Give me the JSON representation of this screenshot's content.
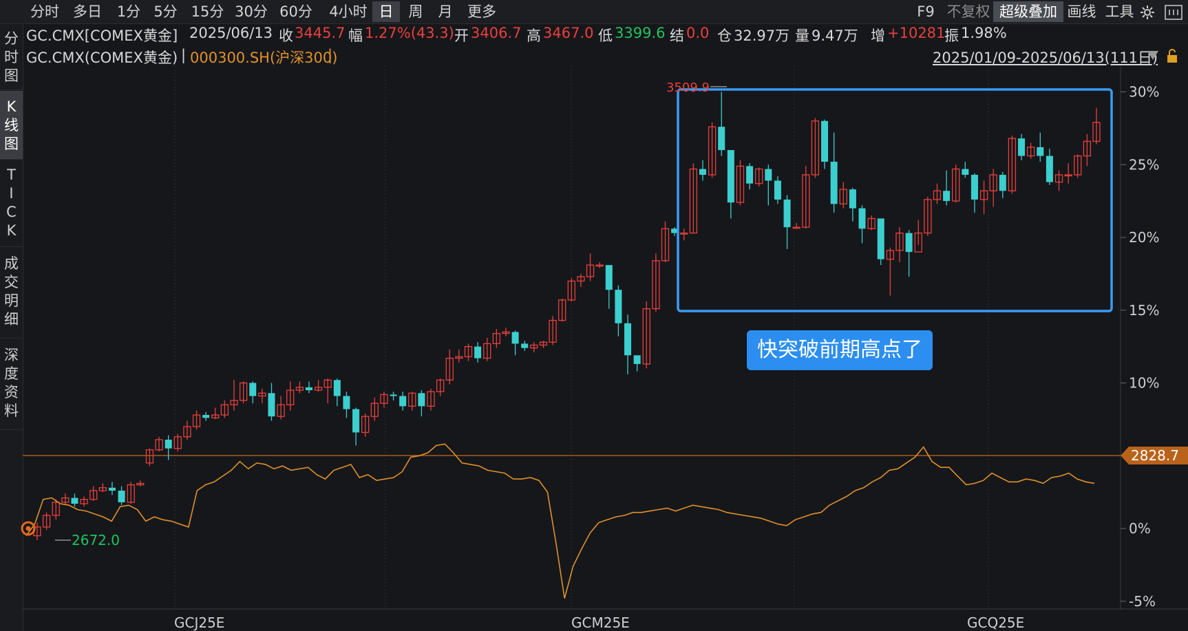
{
  "toolbar": {
    "timeframes": [
      "分时",
      "多日",
      "1分",
      "5分",
      "15分",
      "30分",
      "60分",
      "4小时",
      "日",
      "周",
      "月",
      "更多"
    ],
    "active_timeframe": "日",
    "right_tools": [
      "F9",
      "不复权",
      "超级叠加",
      "画线",
      "工具"
    ],
    "active_tool": "超级叠加",
    "dim_tool": "不复权",
    "settings_icon": "gear-icon"
  },
  "sidebar": {
    "items": [
      {
        "label": "分\n时\n图",
        "active": false
      },
      {
        "label": "K\n线\n图",
        "active": true
      },
      {
        "label": "T\nI\nC\nK",
        "active": false
      },
      {
        "label": "成\n交\n明\n细",
        "active": false
      },
      {
        "label": "深\n度\n资\n料",
        "active": false
      }
    ]
  },
  "info_line1": {
    "symbol": "GC.CMX[COMEX黄金]",
    "date": "2025/06/13",
    "close_label": "收",
    "close_value": "3445.7",
    "change_label": "幅",
    "change_value": "1.27%(43.3)",
    "open_label": "开",
    "open_value": "3406.7",
    "high_label": "高",
    "high_value": "3467.0",
    "low_label": "低",
    "low_value": "3399.6",
    "settle_label": "结",
    "settle_value": "0.0",
    "oi_label": "仓",
    "oi_value": "32.97万",
    "volume_label": "量",
    "volume_value": "9.47万",
    "increase_label": "增",
    "increase_value": "+10281",
    "amplitude_label": "振",
    "amplitude_value": "1.98%"
  },
  "info_line2": {
    "main_series": "GC.CMX(COMEX黄金)",
    "separator": "|",
    "overlay_series": "000300.SH(沪深300)",
    "separator2": "|",
    "date_range": "2025/01/09-2025/06/13(111日)"
  },
  "chart_data": {
    "type": "candlestick",
    "y_axis_ticks": [
      "30%",
      "25%",
      "20%",
      "15%",
      "10%",
      "0%",
      "-5%"
    ],
    "x_axis_labels": [
      "GCJ25E",
      "GCM25E",
      "GCQ25E"
    ],
    "high_annotation": "3509.9",
    "low_annotation": "2672.0",
    "price_tag": "2828.7",
    "colors": {
      "up": "#e8413c",
      "down": "#3ccfcf",
      "overlay": "#e0922a",
      "highlight_box": "#3a9bf5"
    },
    "candles_pct": [
      [
        -0.5,
        0.1,
        -0.8,
        0.4
      ],
      [
        0.1,
        0.9,
        -0.1,
        1.1
      ],
      [
        0.9,
        1.8,
        0.6,
        2.0
      ],
      [
        1.8,
        2.1,
        1.6,
        2.4
      ],
      [
        2.1,
        1.7,
        1.5,
        2.4
      ],
      [
        1.7,
        2.0,
        1.5,
        2.2
      ],
      [
        2.0,
        2.6,
        1.9,
        2.9
      ],
      [
        2.6,
        2.8,
        2.5,
        3.1
      ],
      [
        2.8,
        2.6,
        2.3,
        3.2
      ],
      [
        2.6,
        1.8,
        1.6,
        2.9
      ],
      [
        1.8,
        3.0,
        1.7,
        3.2
      ],
      [
        3.0,
        3.1,
        2.9,
        3.3
      ],
      [
        4.5,
        5.4,
        4.3,
        5.5
      ],
      [
        5.4,
        6.1,
        5.3,
        6.3
      ],
      [
        6.1,
        5.5,
        4.7,
        6.4
      ],
      [
        5.5,
        6.3,
        5.3,
        6.5
      ],
      [
        6.3,
        7.0,
        6.1,
        7.4
      ],
      [
        7.0,
        7.8,
        6.8,
        8.1
      ],
      [
        7.8,
        7.6,
        7.4,
        8.0
      ],
      [
        7.6,
        7.8,
        7.5,
        8.3
      ],
      [
        7.8,
        8.5,
        7.6,
        8.8
      ],
      [
        8.5,
        8.8,
        8.1,
        10.2
      ],
      [
        8.8,
        10.0,
        8.6,
        10.1
      ],
      [
        10.0,
        9.1,
        8.6,
        10.1
      ],
      [
        9.1,
        9.3,
        8.6,
        9.6
      ],
      [
        9.3,
        7.7,
        7.4,
        10.0
      ],
      [
        7.7,
        8.5,
        7.5,
        9.1
      ],
      [
        8.5,
        9.5,
        8.1,
        10.1
      ],
      [
        9.5,
        9.7,
        9.3,
        10.1
      ],
      [
        9.7,
        9.5,
        9.3,
        10.1
      ],
      [
        9.5,
        9.7,
        9.4,
        10.2
      ],
      [
        9.7,
        10.2,
        8.6,
        10.3
      ],
      [
        10.2,
        9.1,
        8.4,
        10.3
      ],
      [
        9.1,
        8.2,
        7.6,
        9.4
      ],
      [
        8.2,
        6.6,
        5.7,
        8.3
      ],
      [
        6.6,
        7.7,
        6.3,
        7.9
      ],
      [
        7.7,
        8.6,
        7.4,
        9.0
      ],
      [
        8.6,
        9.2,
        8.3,
        9.4
      ],
      [
        9.2,
        9.1,
        8.8,
        9.4
      ],
      [
        9.1,
        8.4,
        8.1,
        9.4
      ],
      [
        8.4,
        9.3,
        8.1,
        9.4
      ],
      [
        9.3,
        8.4,
        7.7,
        9.5
      ],
      [
        8.4,
        9.4,
        8.1,
        9.6
      ],
      [
        9.4,
        10.2,
        9.1,
        10.3
      ],
      [
        10.2,
        11.7,
        9.9,
        12.3
      ],
      [
        11.7,
        11.8,
        11.4,
        12.3
      ],
      [
        11.8,
        12.5,
        11.5,
        12.7
      ],
      [
        12.5,
        11.7,
        11.4,
        12.8
      ],
      [
        11.7,
        12.7,
        11.5,
        13.1
      ],
      [
        12.7,
        13.4,
        12.4,
        13.7
      ],
      [
        13.4,
        13.5,
        13.2,
        13.8
      ],
      [
        13.5,
        12.7,
        11.9,
        13.6
      ],
      [
        12.7,
        12.4,
        12.2,
        12.9
      ],
      [
        12.4,
        12.6,
        12.1,
        12.8
      ],
      [
        12.6,
        12.8,
        12.4,
        12.9
      ],
      [
        12.8,
        14.3,
        12.6,
        14.6
      ],
      [
        14.3,
        15.7,
        14.2,
        15.8
      ],
      [
        15.7,
        17.0,
        15.6,
        17.2
      ],
      [
        17.0,
        17.3,
        16.6,
        17.5
      ],
      [
        17.3,
        18.1,
        17.0,
        18.9
      ],
      [
        18.1,
        18.1,
        17.9,
        18.3
      ],
      [
        18.1,
        16.4,
        15.1,
        17.9
      ],
      [
        16.4,
        14.1,
        13.2,
        16.7
      ],
      [
        14.1,
        11.9,
        10.6,
        14.7
      ],
      [
        11.9,
        11.3,
        10.8,
        11.6
      ],
      [
        11.3,
        15.1,
        11.0,
        15.6
      ],
      [
        15.1,
        18.4,
        14.9,
        18.9
      ],
      [
        18.4,
        20.6,
        18.3,
        21.1
      ],
      [
        20.6,
        20.3,
        20.1,
        20.7
      ],
      [
        20.3,
        20.3,
        19.8,
        20.6
      ],
      [
        20.3,
        24.7,
        20.3,
        25.1
      ],
      [
        24.7,
        24.3,
        23.9,
        25.3
      ],
      [
        24.3,
        27.6,
        24.1,
        27.9
      ],
      [
        27.6,
        26.0,
        25.6,
        30.0
      ],
      [
        26.0,
        22.4,
        21.3,
        25.8
      ],
      [
        22.4,
        24.9,
        22.2,
        25.3
      ],
      [
        24.9,
        23.7,
        23.3,
        25.1
      ],
      [
        23.7,
        24.7,
        23.5,
        24.8
      ],
      [
        24.7,
        23.9,
        22.2,
        25.0
      ],
      [
        23.9,
        22.6,
        22.3,
        24.2
      ],
      [
        22.6,
        20.7,
        19.2,
        22.9
      ],
      [
        20.7,
        20.7,
        20.6,
        21.0
      ],
      [
        20.7,
        24.3,
        20.6,
        24.9
      ],
      [
        24.3,
        28.0,
        24.1,
        28.2
      ],
      [
        28.0,
        25.2,
        24.7,
        28.1
      ],
      [
        25.2,
        22.3,
        21.7,
        27.2
      ],
      [
        22.3,
        23.3,
        22.0,
        23.8
      ],
      [
        23.3,
        22.0,
        21.1,
        23.4
      ],
      [
        22.0,
        20.6,
        19.6,
        22.2
      ],
      [
        20.6,
        21.3,
        20.5,
        21.5
      ],
      [
        21.3,
        18.5,
        18.1,
        21.1
      ],
      [
        18.5,
        19.1,
        16.0,
        19.3
      ],
      [
        19.1,
        20.3,
        18.3,
        20.7
      ],
      [
        20.3,
        19.0,
        17.3,
        20.5
      ],
      [
        19.0,
        20.3,
        19.5,
        21.2
      ],
      [
        20.3,
        22.6,
        20.1,
        22.8
      ],
      [
        22.6,
        23.2,
        22.3,
        23.7
      ],
      [
        23.2,
        22.5,
        22.2,
        24.6
      ],
      [
        22.5,
        24.7,
        22.4,
        25.0
      ],
      [
        24.7,
        24.3,
        24.1,
        25.2
      ],
      [
        24.3,
        22.6,
        21.7,
        24.4
      ],
      [
        22.6,
        23.2,
        21.6,
        23.9
      ],
      [
        23.2,
        24.3,
        22.1,
        24.7
      ],
      [
        24.3,
        23.2,
        22.7,
        24.5
      ],
      [
        23.2,
        26.8,
        23.0,
        27.0
      ],
      [
        26.8,
        25.6,
        25.3,
        27.1
      ],
      [
        25.6,
        26.2,
        25.4,
        26.5
      ],
      [
        26.2,
        25.6,
        25.2,
        27.2
      ],
      [
        25.6,
        23.8,
        23.6,
        26.1
      ],
      [
        23.8,
        24.3,
        23.2,
        24.6
      ],
      [
        24.3,
        24.3,
        23.7,
        25.1
      ],
      [
        24.3,
        25.6,
        24.1,
        25.7
      ],
      [
        25.6,
        26.6,
        24.9,
        27.1
      ],
      [
        26.6,
        27.9,
        26.4,
        28.9
      ]
    ],
    "overlay_pct": [
      -0.5,
      0.3,
      2.0,
      2.1,
      1.7,
      1.6,
      1.3,
      1.2,
      1.0,
      0.8,
      0.5,
      1.5,
      1.6,
      1.3,
      0.5,
      0.8,
      0.6,
      0.5,
      0.3,
      0.1,
      2.6,
      3.0,
      3.2,
      3.6,
      4.0,
      4.6,
      4.1,
      4.5,
      4.4,
      4.1,
      4.3,
      4.0,
      4.1,
      4.2,
      3.7,
      3.4,
      4.0,
      4.2,
      4.4,
      3.5,
      3.7,
      3.3,
      3.4,
      3.5,
      3.9,
      4.9,
      5.0,
      5.2,
      5.7,
      5.8,
      5.2,
      4.5,
      4.4,
      4.3,
      4.0,
      3.9,
      3.8,
      3.4,
      3.4,
      3.5,
      3.3,
      2.5,
      -1.0,
      -4.8,
      -2.6,
      -1.4,
      -0.3,
      0.4,
      0.6,
      0.8,
      0.9,
      1.1,
      1.1,
      1.2,
      1.3,
      1.4,
      1.2,
      1.4,
      1.6,
      1.5,
      1.4,
      1.3,
      1.1,
      1.0,
      0.9,
      0.8,
      0.7,
      0.5,
      0.3,
      0.2,
      0.6,
      0.8,
      1.0,
      1.1,
      1.6,
      1.9,
      2.2,
      2.6,
      2.8,
      3.2,
      3.5,
      4.0,
      4.1,
      4.5,
      4.9,
      5.6,
      4.6,
      4.2,
      4.2,
      3.6,
      3.0,
      3.1,
      3.3,
      3.8,
      3.5,
      3.2,
      3.2,
      3.4,
      3.3,
      3.1,
      3.5,
      3.6,
      3.8,
      3.4,
      3.2,
      3.1
    ]
  },
  "callout": {
    "text": "快突破前期高点了"
  }
}
